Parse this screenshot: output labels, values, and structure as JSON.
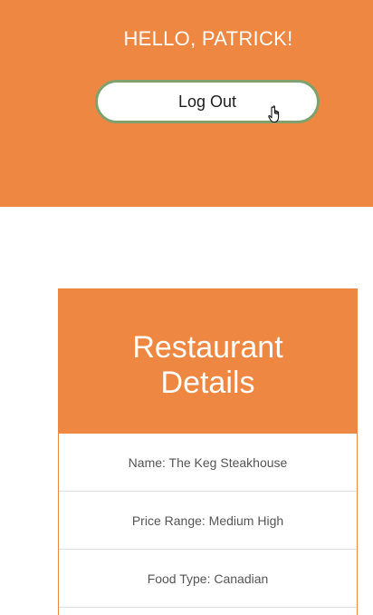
{
  "header": {
    "greeting": "HELLO, PATRICK!",
    "logout_label": "Log Out",
    "cursor_icon": "hand-pointer-icon"
  },
  "restaurant": {
    "title_line1": "Restaurant",
    "title_line2": "Details",
    "details": [
      {
        "text": "Name: The Keg Steakhouse"
      },
      {
        "text": "Price Range: Medium High"
      },
      {
        "text": "Food Type: Canadian"
      }
    ]
  },
  "colors": {
    "accent": "#EE8742",
    "button_border": "#7FA16E",
    "text_muted": "#555555"
  }
}
